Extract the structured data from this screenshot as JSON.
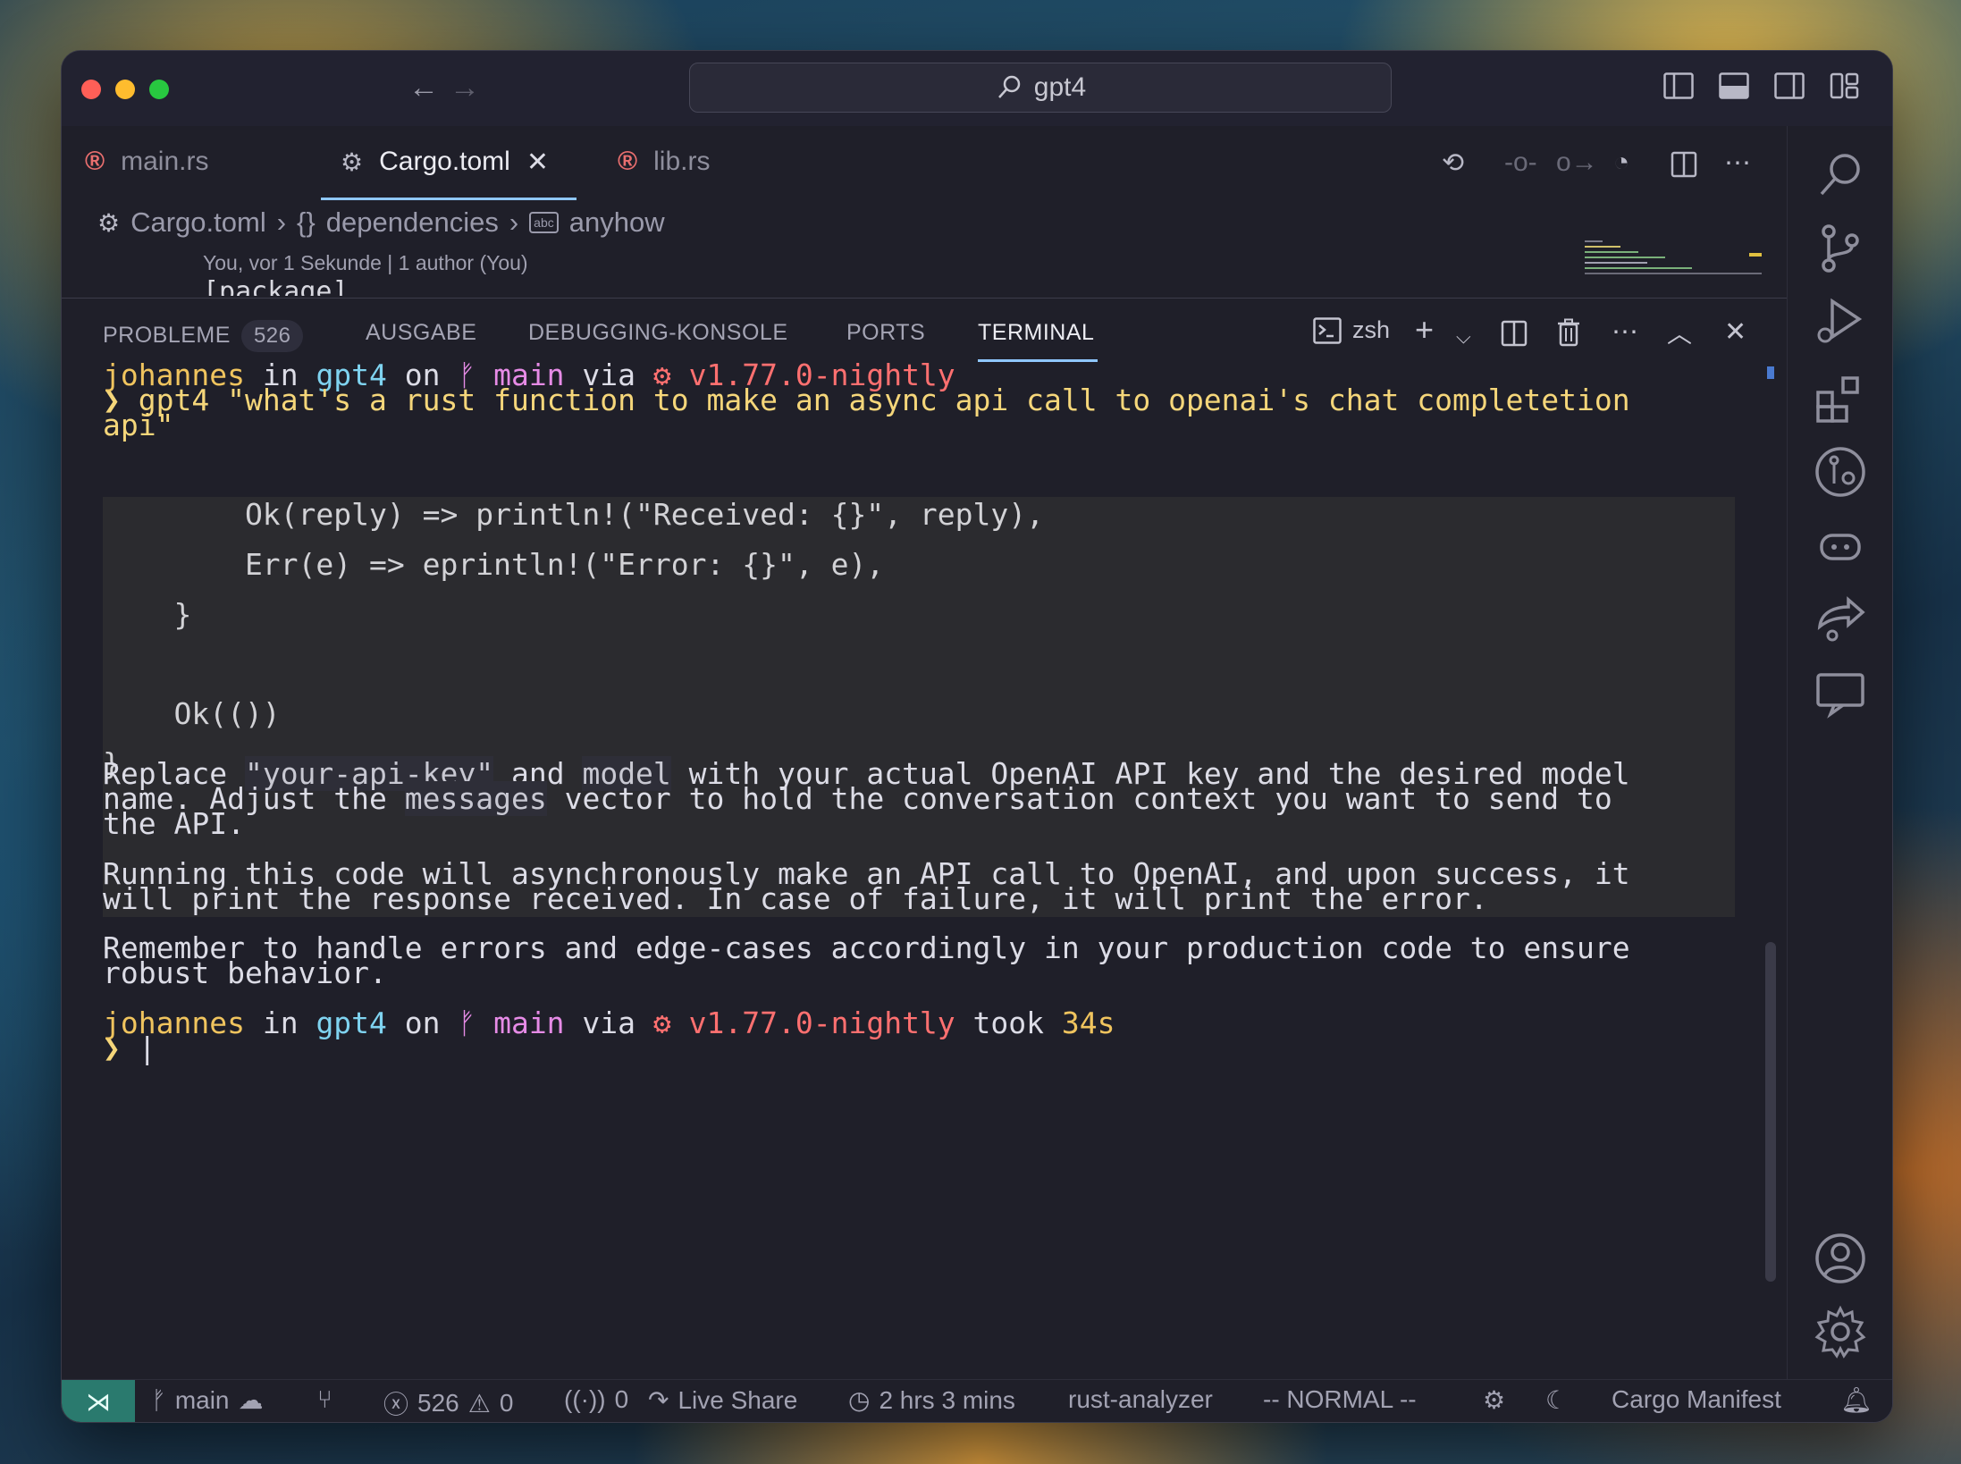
{
  "titlebar": {
    "search_text": "gpt4"
  },
  "tabs": [
    {
      "label": "main.rs",
      "icon": "rust-icon"
    },
    {
      "label": "Cargo.toml",
      "icon": "gear-icon",
      "close": "✕"
    },
    {
      "label": "lib.rs",
      "icon": "rust-icon"
    }
  ],
  "breadcrumb": {
    "file": "Cargo.toml",
    "section": "dependencies",
    "section_prefix": "{}",
    "item": "anyhow"
  },
  "blame": "You, vor 1 Sekunde | 1 author (You)",
  "editor_peek": "[package]",
  "panel": {
    "tabs": {
      "problems": "PROBLEME",
      "problems_count": "526",
      "output": "AUSGABE",
      "debug": "DEBUGGING-KONSOLE",
      "ports": "PORTS",
      "terminal": "TERMINAL"
    },
    "shell": "zsh"
  },
  "terminal": {
    "prompt1": {
      "user": "johannes",
      "in": " in ",
      "dir": "gpt4",
      "on": " on ",
      "branch_icon": "",
      "branch": "main",
      "via": " via ",
      "rust_icon": "⚙",
      "version": "v1.77.0-nightly"
    },
    "command_line1": "gpt4 \"what's a rust function to make an async api call to openai's chat completetion",
    "command_line2": "api\"",
    "prompt_char": "❯",
    "code_lines": [
      "        Ok(reply) => println!(\"Received: {}\", reply),",
      "        Err(e) => eprintln!(\"Error: {}\", e),",
      "    }",
      "    Ok(())",
      "}"
    ],
    "para1_a": "Replace ",
    "para1_code1": "\"your-api-key\"",
    "para1_b": " and ",
    "para1_code2": "model",
    "para1_c": " with your actual OpenAI API key and the desired model",
    "para1_line2_a": "name. Adjust the ",
    "para1_code3": "messages",
    "para1_line2_b": " vector to hold the conversation context you want to send to",
    "para1_line3": "the API.",
    "para2_line1": "Running this code will asynchronously make an API call to OpenAI, and upon success, it",
    "para2_line2": "will print the response received. In case of failure, it will print the error.",
    "para3_line1": "Remember to handle errors and edge-cases accordingly in your production code to ensure",
    "para3_line2": "robust behavior.",
    "prompt2": {
      "user": "johannes",
      "dir": "gpt4",
      "branch": "main",
      "version": "v1.77.0-nightly",
      "took": " took ",
      "duration": "34s"
    }
  },
  "statusbar": {
    "branch": "main",
    "errors": "526",
    "warnings": "0",
    "ports": "0",
    "live_share": "Live Share",
    "time": "2 hrs 3 mins",
    "analyzer": "rust-analyzer",
    "mode": "-- NORMAL --",
    "manifest": "Cargo Manifest"
  },
  "colors": {
    "accent": "#8fc7ff",
    "user": "#f0c45e",
    "dir": "#7fd3f0",
    "branch": "#e68be6",
    "version": "#ff7070"
  }
}
